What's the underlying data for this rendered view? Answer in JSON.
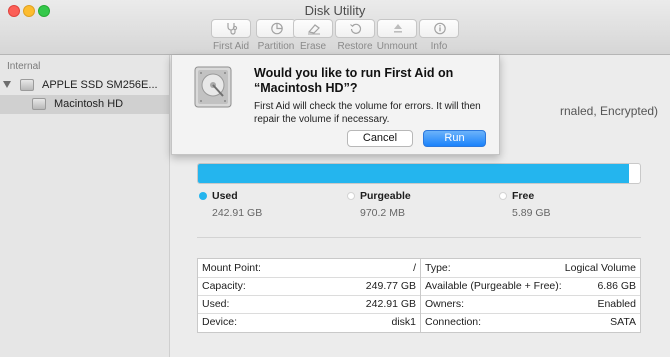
{
  "window": {
    "title": "Disk Utility"
  },
  "toolbar": {
    "items": [
      {
        "label": "First Aid",
        "icon": "stethoscope-icon"
      },
      {
        "label": "Partition",
        "icon": "pie-icon"
      },
      {
        "label": "Erase",
        "icon": "erase-icon"
      },
      {
        "label": "Restore",
        "icon": "restore-icon"
      },
      {
        "label": "Unmount",
        "icon": "eject-icon"
      },
      {
        "label": "Info",
        "icon": "info-icon"
      }
    ]
  },
  "sidebar": {
    "section_header": "Internal",
    "disk": {
      "label": "APPLE SSD SM256E..."
    },
    "volume": {
      "label": "Macintosh HD",
      "selected": true
    }
  },
  "volume": {
    "detail_fragment": "rnaled, Encrypted)",
    "used_fraction": 0.975
  },
  "legend": {
    "used": {
      "label": "Used",
      "value": "242.91 GB",
      "color": "#24b5ee"
    },
    "purgeable": {
      "label": "Purgeable",
      "value": "970.2 MB",
      "color": "#ffffff"
    },
    "free": {
      "label": "Free",
      "value": "5.89 GB",
      "color": "#ffffff"
    }
  },
  "info": {
    "left": [
      {
        "key": "Mount Point:",
        "value": "/"
      },
      {
        "key": "Capacity:",
        "value": "249.77 GB"
      },
      {
        "key": "Used:",
        "value": "242.91 GB"
      },
      {
        "key": "Device:",
        "value": "disk1"
      }
    ],
    "right": [
      {
        "key": "Type:",
        "value": "Logical Volume"
      },
      {
        "key": "Available (Purgeable + Free):",
        "value": "6.86 GB"
      },
      {
        "key": "Owners:",
        "value": "Enabled"
      },
      {
        "key": "Connection:",
        "value": "SATA"
      }
    ]
  },
  "dialog": {
    "title": "Would you like to run First Aid on “Macintosh HD”?",
    "message": "First Aid will check the volume for errors. It will then repair the volume if necessary.",
    "cancel_label": "Cancel",
    "run_label": "Run",
    "icon": "hard-drive-icon"
  }
}
